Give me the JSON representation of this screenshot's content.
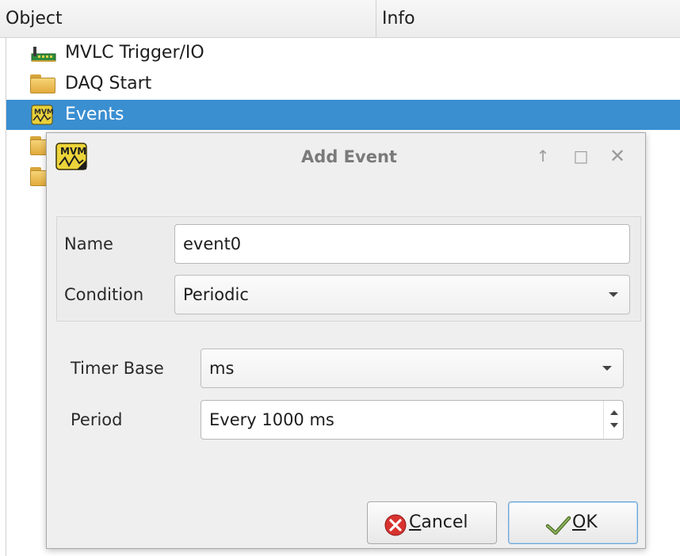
{
  "tree": {
    "columns": {
      "object": "Object",
      "info": "Info"
    },
    "items": [
      {
        "label": "MVLC Trigger/IO",
        "icon": "io-board-icon"
      },
      {
        "label": "DAQ Start",
        "icon": "folder-icon"
      },
      {
        "label": "Events",
        "icon": "mvme-event-icon",
        "selected": true
      },
      {
        "label": "",
        "icon": "folder-icon"
      },
      {
        "label": "",
        "icon": "folder-icon"
      }
    ],
    "selection_color": "#3a8fd1"
  },
  "dialog": {
    "title": "Add Event",
    "name_label": "Name",
    "name_value": "event0",
    "condition_label": "Condition",
    "condition_value": "Periodic",
    "timer_base_label": "Timer Base",
    "timer_base_value": "ms",
    "period_label": "Period",
    "period_value": "Every 1000 ms",
    "cancel_prefix": "",
    "cancel_mnemonic": "C",
    "cancel_rest": "ancel",
    "ok_mnemonic": "O",
    "ok_rest": "K",
    "ok_border_color": "#6fa5d6"
  }
}
